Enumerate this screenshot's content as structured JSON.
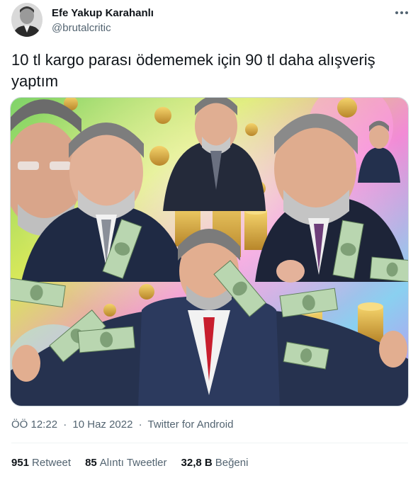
{
  "author": {
    "display_name": "Efe Yakup Karahanlı",
    "handle": "@brutalcritic"
  },
  "tweet": {
    "text": "10 tl kargo parası ödememek için 90 tl daha alışveriş yaptım"
  },
  "meta": {
    "time": "ÖÖ 12:22",
    "separator": "·",
    "date": "10 Haz 2022",
    "source": "Twitter for Android"
  },
  "stats": {
    "retweets_count": "951",
    "retweets_label": "Retweet",
    "quotes_count": "85",
    "quotes_label": "Alıntı Tweetler",
    "likes_count": "32,8 B",
    "likes_label": "Beğeni"
  },
  "colors": {
    "text_primary": "#0f1419",
    "text_secondary": "#536471",
    "divider": "#eff3f4"
  },
  "icons": {
    "more": "more-horizontal-icon"
  }
}
